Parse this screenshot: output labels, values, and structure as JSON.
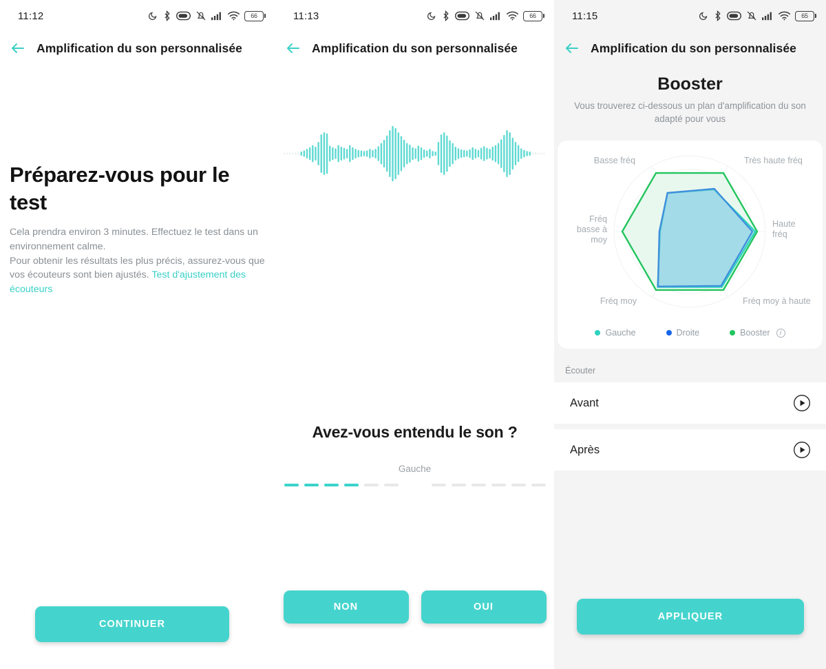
{
  "accent": "#45d4cd",
  "panels": [
    {
      "status": {
        "time": "11:12",
        "battery": "66",
        "icons": [
          "do-not-disturb-moon-icon",
          "bluetooth-icon",
          "battery-saver-icon",
          "mute-bell-icon",
          "signal-bars-icon",
          "wifi-icon",
          "battery-icon"
        ]
      },
      "appbar": {
        "title": "Amplification du son personnalisée",
        "back_icon": "back-arrow-icon"
      },
      "title": "Préparez-vous pour le test",
      "desc_line1": "Cela prendra environ 3 minutes. Effectuez le test dans un environnement calme.",
      "desc_line2": "Pour obtenir les résultats les plus précis, assurez-vous que vos écouteurs sont bien ajustés. ",
      "desc_link": "Test d'ajustement des écouteurs",
      "cta": "CONTINUER"
    },
    {
      "status": {
        "time": "11:13",
        "battery": "66"
      },
      "appbar": {
        "title": "Amplification du son personnalisée"
      },
      "waveform_label": "audio-waveform",
      "question": "Avez-vous entendu le son ?",
      "side": "Gauche",
      "progress": {
        "left_total": 6,
        "left_filled": 4,
        "right_total": 6,
        "right_filled": 0
      },
      "cta_no": "NON",
      "cta_yes": "OUI"
    },
    {
      "status": {
        "time": "11:15",
        "battery": "65"
      },
      "appbar": {
        "title": "Amplification du son personnalisée"
      },
      "title": "Booster",
      "subtitle": "Vous trouverez ci-dessous un plan d'amplification du son adapté pour vous",
      "legend": [
        {
          "label": "Gauche",
          "color": "#2ed3bf"
        },
        {
          "label": "Droite",
          "color": "#1565e8"
        },
        {
          "label": "Booster",
          "color": "#22c55e",
          "info": true
        }
      ],
      "section_label": "Écouter",
      "rows": [
        {
          "label": "Avant",
          "icon": "play-circle-icon"
        },
        {
          "label": "Après",
          "icon": "play-circle-icon"
        }
      ],
      "cta": "APPLIQUER"
    }
  ],
  "chart_data": {
    "type": "radar",
    "title": "Booster",
    "categories": [
      "Très haute fréq",
      "Haute fréq",
      "Fréq moy à haute",
      "Fréq moy",
      "Fréq basse à moy",
      "Basse fréq"
    ],
    "rmax": 100,
    "grid": true,
    "legend_position": "bottom",
    "series": [
      {
        "name": "Booster",
        "color": "#22c55e",
        "fill": "#e9f8ee",
        "values": [
          100,
          100,
          100,
          100,
          100,
          100
        ]
      },
      {
        "name": "Gauche",
        "color": "#2ed3bf",
        "fill": "rgba(120,210,230,0.30)",
        "values": [
          72,
          97,
          95,
          95,
          44,
          66
        ]
      },
      {
        "name": "Droite",
        "color": "#3f8fdc",
        "fill": "rgba(120,200,228,0.45)",
        "values": [
          73,
          93,
          93,
          94,
          45,
          66
        ]
      }
    ]
  }
}
